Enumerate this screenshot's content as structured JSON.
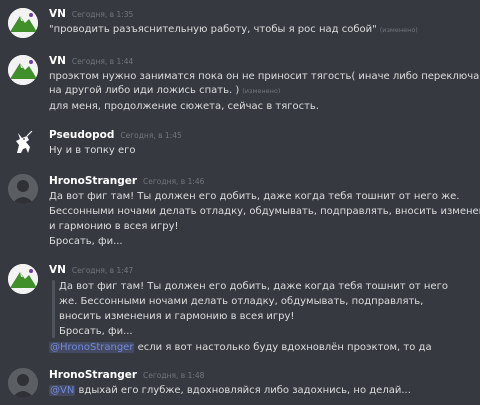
{
  "accent": "#7289da",
  "messages": [
    {
      "author": "VN",
      "timestamp": "Сегодня, в 1:35",
      "lines": [
        "\"проводить разъяснительную работу, чтобы я рос над собой\""
      ],
      "edited": "(изменено)"
    },
    {
      "author": "VN",
      "timestamp": "Сегодня, в 1:44",
      "lines": [
        "проэктом нужно заниматся пока он не приносит тягость( иначе либо переключайся",
        "на другой либо иди ложись спать. )",
        "для меня, продолжение сюжета, сейчас в тягость."
      ],
      "edited": "(изменено)"
    },
    {
      "author": "Pseudopod",
      "timestamp": "Сегодня, в 1:45",
      "lines": [
        "Ну и в топку его"
      ]
    },
    {
      "author": "HronoStranger",
      "timestamp": "Сегодня, в 1:46",
      "lines": [
        "Да вот фиг там! Ты должен его добить, даже когда тебя тошнит от него же.",
        "Бессонными ночами делать отладку, обдумывать, подправлять, вносить изменения",
        "и гармонию в всея игру!",
        "Бросать, фи..."
      ]
    },
    {
      "author": "VN",
      "timestamp": "Сегодня, в 1:47",
      "quote": [
        "Да вот фиг там! Ты должен его добить, даже когда тебя тошнит от него",
        "же. Бессонными ночами делать отладку, обдумывать, подправлять,",
        "вносить изменения и гармонию в всея игру!",
        "Бросать, фи..."
      ],
      "mention": "@HronoStranger",
      "text": " если я вот настолько буду вдохновлён проэктом, то да"
    },
    {
      "author": "HronoStranger",
      "timestamp": "Сегодня, в 1:48",
      "mention": "@VN",
      "text": " вдыхай его глубже, вдохновляйся либо задохнись, но делай..."
    }
  ]
}
